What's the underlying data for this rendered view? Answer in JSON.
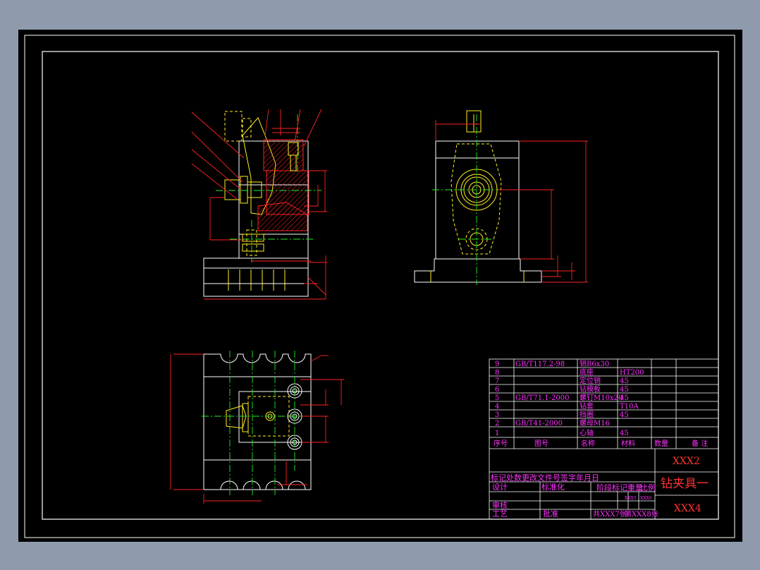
{
  "title_block": {
    "drawing_no_1": "XXX2",
    "part_name": "钻夹具一",
    "drawing_no_2": "XXX4",
    "mark_row": "标记处数更改文件号签字年月日",
    "design": "设计",
    "standardization": "标准化",
    "stage_mark": "阶段标记",
    "weight": "重量",
    "scale": "比例",
    "review": "审核",
    "process": "工艺",
    "approve": "批准",
    "small_1": "XXX5",
    "small_2": "XXX6",
    "sheets_total": "共XXX7张",
    "sheet_no": "第XXX8张"
  },
  "bom": {
    "headers": [
      "序号",
      "图号",
      "名称",
      "材料",
      "数量",
      "备 注"
    ],
    "rows": [
      {
        "no": "9",
        "code": "GB/T117.2-98",
        "name": "销B6x30",
        "material": ""
      },
      {
        "no": "8",
        "code": "",
        "name": "底座",
        "material": "HT200"
      },
      {
        "no": "7",
        "code": "",
        "name": "定位销",
        "material": "45"
      },
      {
        "no": "6",
        "code": "",
        "name": "钻模板",
        "material": "45"
      },
      {
        "no": "5",
        "code": "GB/T71.1-2000",
        "name": "螺钉M10x20",
        "material": "45"
      },
      {
        "no": "4",
        "code": "",
        "name": "钻套",
        "material": "T10A"
      },
      {
        "no": "3",
        "code": "",
        "name": "挡圈",
        "material": "45"
      },
      {
        "no": "2",
        "code": "GB/T41-2000",
        "name": "螺母M16",
        "material": ""
      },
      {
        "no": "1",
        "code": "",
        "name": "心轴",
        "material": "45"
      }
    ]
  },
  "colors": {
    "sheet": "#000000",
    "outer": "#8f9bad",
    "outline": "#ffffff",
    "dimension": "#ff2222",
    "centerline": "#22ee22",
    "part": "#ffee22",
    "text": "#ff33ff"
  }
}
